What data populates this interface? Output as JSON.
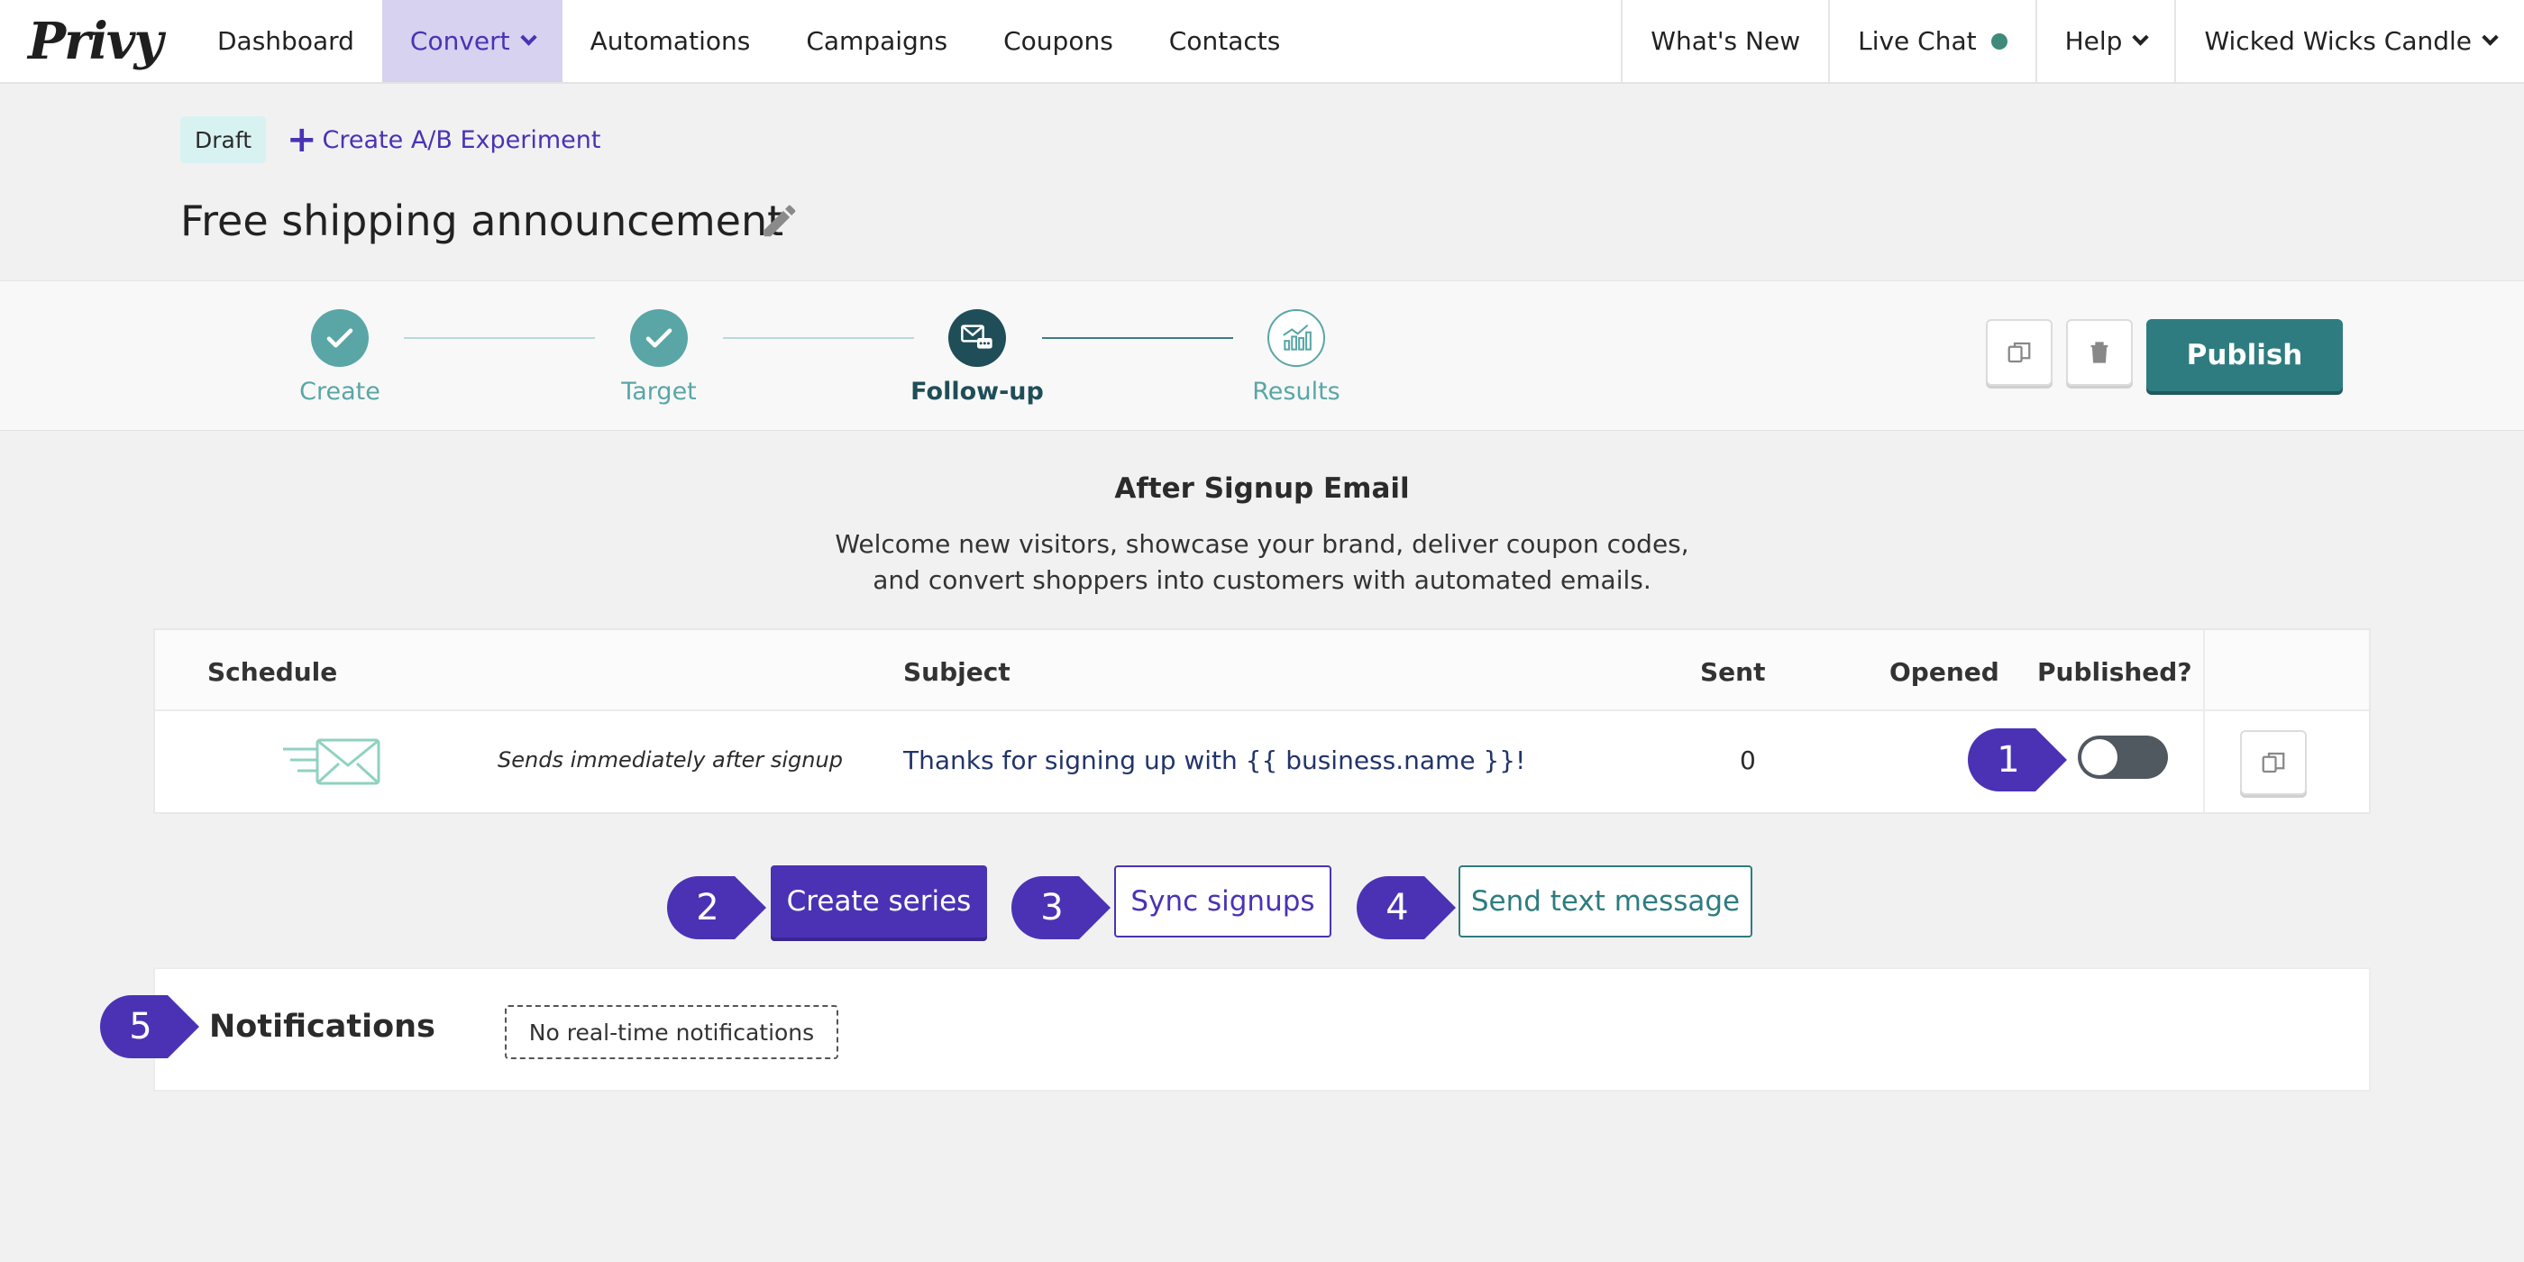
{
  "logo": "Privy",
  "nav": {
    "dashboard": "Dashboard",
    "convert": "Convert",
    "automations": "Automations",
    "campaigns": "Campaigns",
    "coupons": "Coupons",
    "contacts": "Contacts",
    "whats_new": "What's New",
    "live_chat": "Live Chat",
    "help": "Help",
    "account": "Wicked Wicks Candle"
  },
  "header": {
    "status_badge": "Draft",
    "ab_link": "Create A/B Experiment",
    "ab_icon": "plus-icon",
    "title": "Free shipping announcement",
    "edit_icon": "pencil-icon"
  },
  "stepper": {
    "steps": [
      {
        "label": "Create",
        "state": "complete",
        "icon": "check-icon"
      },
      {
        "label": "Target",
        "state": "complete",
        "icon": "check-icon"
      },
      {
        "label": "Follow-up",
        "state": "current",
        "icon": "email-chat-icon"
      },
      {
        "label": "Results",
        "state": "upcoming",
        "icon": "bar-chart-icon"
      }
    ]
  },
  "actions": {
    "duplicate_icon": "copy-icon",
    "delete_icon": "trash-icon",
    "publish_label": "Publish"
  },
  "after_signup": {
    "title": "After Signup Email",
    "description": "Welcome new visitors, showcase your brand, deliver coupon codes, and convert shoppers into customers with automated emails."
  },
  "email_table": {
    "headers": {
      "schedule": "Schedule",
      "subject": "Subject",
      "sent": "Sent",
      "opened": "Opened",
      "published": "Published?"
    },
    "rows": [
      {
        "icon": "email-send-icon",
        "schedule": "Sends immediately after signup",
        "subject": "Thanks for signing up with {{ business.name }}!",
        "sent": "0",
        "opened": "",
        "published": false
      }
    ]
  },
  "buttons": {
    "create_series": "Create series",
    "sync_signups": "Sync signups",
    "send_text": "Send text message"
  },
  "notifications": {
    "title": "Notifications",
    "empty_text": "No real-time notifications"
  },
  "callouts": [
    "1",
    "2",
    "3",
    "4",
    "5"
  ],
  "colors": {
    "brand_purple": "#4b32b5",
    "teal": "#2e7c80",
    "step_done": "#5aa6a6",
    "step_current": "#1f4e58",
    "live_dot": "#3f8a7a"
  }
}
